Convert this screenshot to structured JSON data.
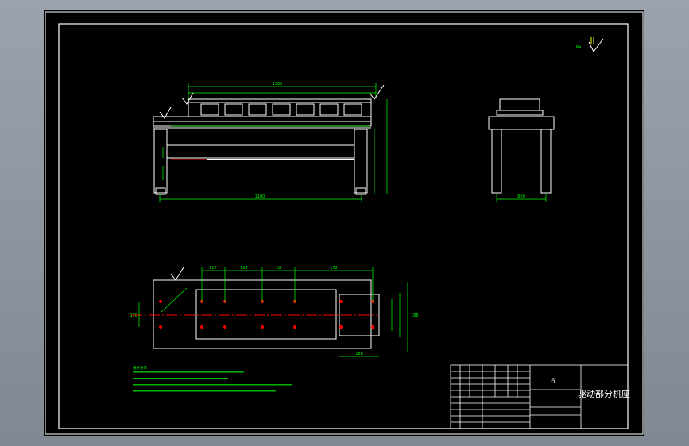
{
  "title_block": {
    "drawing_name": "驱动部分机座",
    "scale_glyph": "6"
  },
  "top_view_dims": {
    "overall_length": "1360",
    "leg_span": "1180"
  },
  "plan_view_dims": {
    "d1": "117",
    "d2": "117",
    "d3": "18",
    "d4": "172",
    "left_height": "170",
    "right_height": "188",
    "bottom_width": "188"
  },
  "side_view_dims": {
    "width": "600"
  },
  "notes_heading": "技术要求"
}
